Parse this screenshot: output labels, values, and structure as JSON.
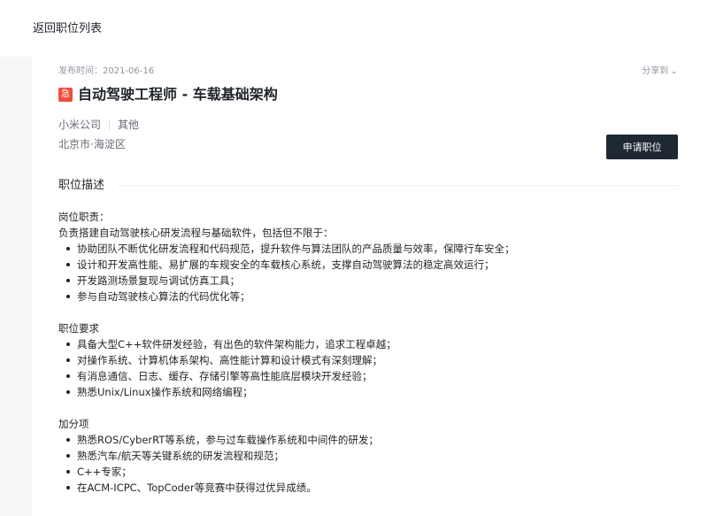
{
  "nav": {
    "back_label": "返回职位列表"
  },
  "job": {
    "publish_time": "发布时间：2021-06-16",
    "share_label": "分享到",
    "urgent_badge": "急",
    "title": "自动驾驶工程师 - 车载基础架构",
    "company": "小米公司",
    "category": "其他",
    "location": "北京市·海淀区",
    "apply_label": "申请职位"
  },
  "description": {
    "section_title": "职位描述",
    "duties_heading": "岗位职责：",
    "duties_intro": "负责搭建自动驾驶核心研发流程与基础软件，包括但不限于：",
    "duties": [
      "协助团队不断优化研发流程和代码规范，提升软件与算法团队的产品质量与效率，保障行车安全；",
      "设计和开发高性能、易扩展的车规安全的车载核心系统，支撑自动驾驶算法的稳定高效运行；",
      "开发路测场景复现与调试仿真工具；",
      "参与自动驾驶核心算法的代码优化等；"
    ],
    "requirements_heading": "职位要求",
    "requirements": [
      "具备大型C++软件研发经验，有出色的软件架构能力，追求工程卓越；",
      "对操作系统、计算机体系架构、高性能计算和设计模式有深刻理解；",
      "有消息通信、日志、缓存、存储引擎等高性能底层模块开发经验；",
      "熟悉Unix/Linux操作系统和网络编程；"
    ],
    "bonus_heading": "加分项",
    "bonus": [
      "熟悉ROS/CyberRT等系统，参与过车载操作系统和中间件的研发；",
      "熟悉汽车/航天等关键系统的研发流程和规范；",
      "C++专家；",
      "在ACM-ICPC、TopCoder等竞赛中获得过优异成绩。"
    ]
  }
}
